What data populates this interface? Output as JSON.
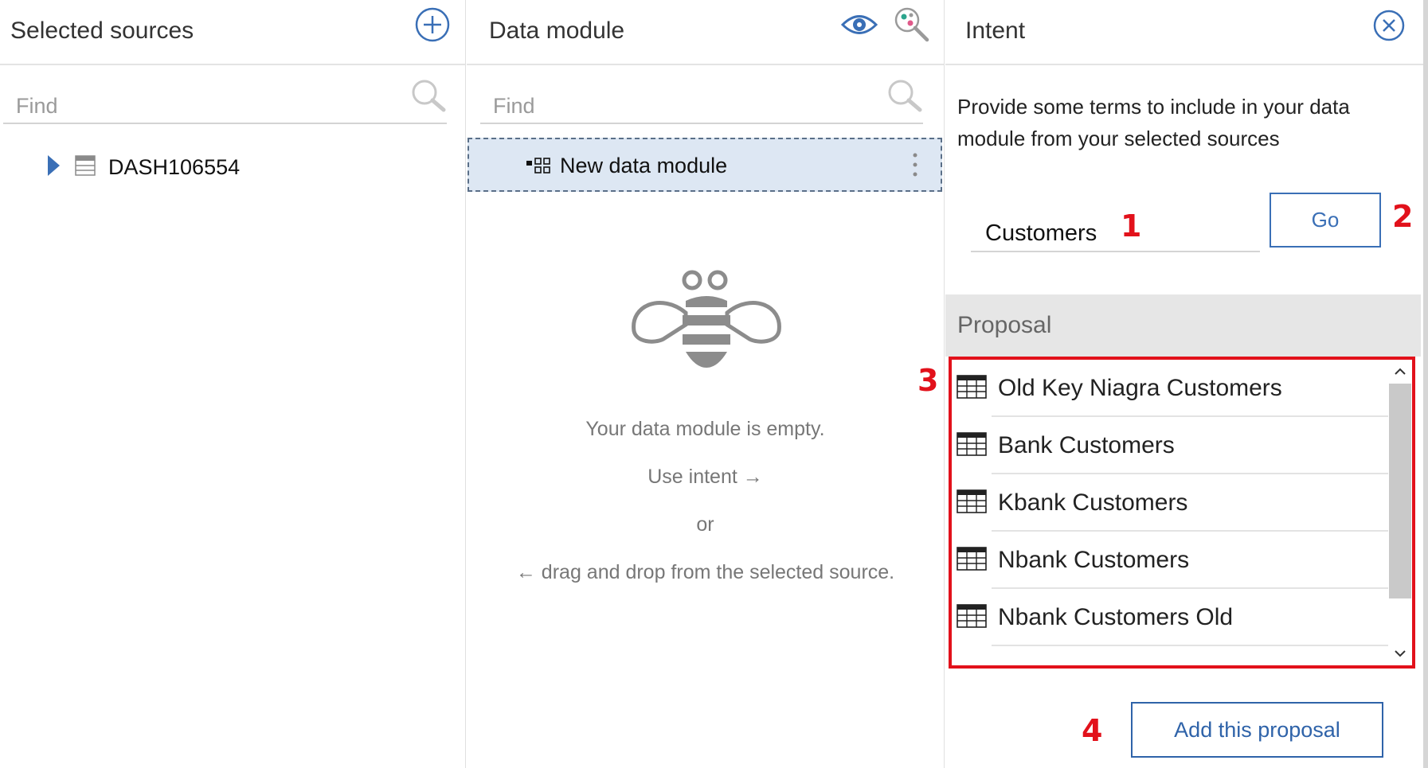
{
  "selected_sources": {
    "title": "Selected sources",
    "find_placeholder": "Find",
    "tree": [
      {
        "label": "DASH106554"
      }
    ]
  },
  "data_module": {
    "title": "Data module",
    "find_placeholder": "Find",
    "module_name": "New data module",
    "empty": {
      "line1": "Your data module is empty.",
      "line2": "Use intent →",
      "line3": "or",
      "line4": "← drag and drop from the selected source."
    }
  },
  "intent": {
    "title": "Intent",
    "description": "Provide some terms to include in your data module from your selected sources",
    "term_value": "Customers",
    "go_label": "Go",
    "proposal_title": "Proposal",
    "proposals": [
      {
        "label": "Old Key Niagra Customers"
      },
      {
        "label": "Bank Customers"
      },
      {
        "label": "Kbank Customers"
      },
      {
        "label": "Nbank Customers"
      },
      {
        "label": "Nbank Customers Old"
      }
    ],
    "add_label": "Add this proposal"
  },
  "annotations": {
    "m1": "1",
    "m2": "2",
    "m3": "3",
    "m4": "4"
  },
  "icons": {
    "add": "add-source-icon",
    "preview": "eye-icon",
    "discover": "relationship-search-icon",
    "close": "close-circle-icon",
    "search": "search-icon",
    "expand": "triangle-right-icon",
    "source": "database-icon",
    "module": "data-module-icon",
    "more": "kebab-menu-icon",
    "table": "table-icon"
  },
  "colors": {
    "accent": "#3a6fb6",
    "highlight": "#e2111b",
    "selected_row": "#dde7f3"
  }
}
